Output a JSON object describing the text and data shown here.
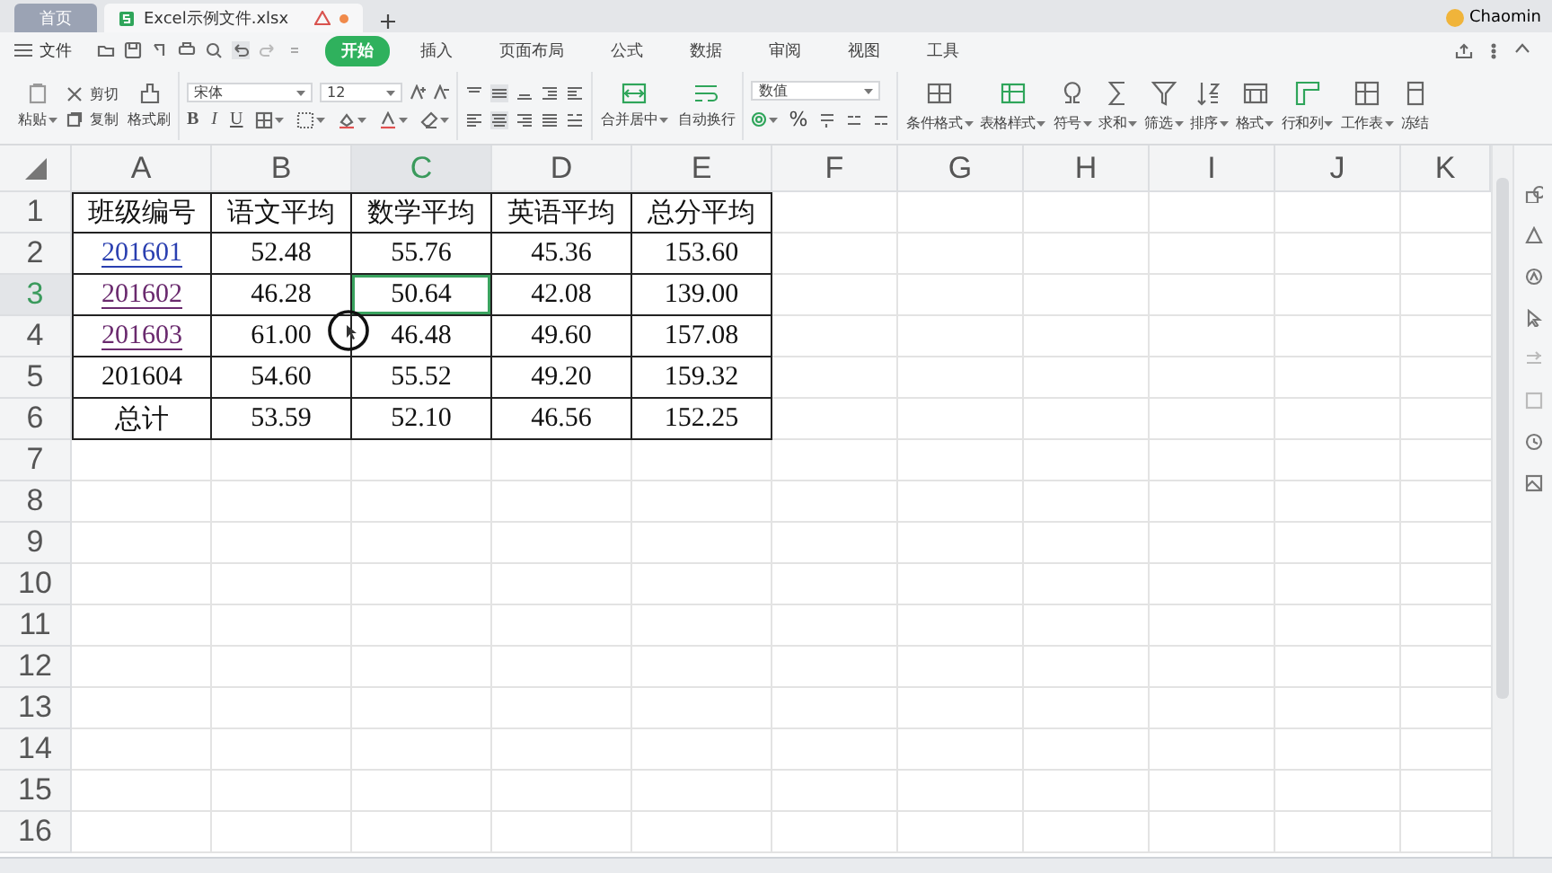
{
  "tabs": [
    {
      "label": "首页",
      "kind": "home",
      "selected": false
    },
    {
      "label": "Excel示例文件.xlsx",
      "kind": "document",
      "selected": true
    }
  ],
  "user": {
    "name": "Chaomin"
  },
  "menu": {
    "file": "文件",
    "tabs": [
      {
        "label": "开始",
        "selected": true
      },
      {
        "label": "插入",
        "selected": false
      },
      {
        "label": "页面布局",
        "selected": false
      },
      {
        "label": "公式",
        "selected": false
      },
      {
        "label": "数据",
        "selected": false
      },
      {
        "label": "审阅",
        "selected": false
      },
      {
        "label": "视图",
        "selected": false
      },
      {
        "label": "工具",
        "selected": false
      }
    ]
  },
  "ribbon": {
    "paste": {
      "label": "粘贴",
      "dropdown": true
    },
    "cut": "剪切",
    "copy": "复制",
    "format_painter": "格式刷",
    "font": {
      "name": "宋体",
      "size": "12",
      "bold": "B",
      "italic": "I",
      "underline": "U"
    },
    "merge": {
      "label": "合并居中",
      "dropdown": true
    },
    "wrap": {
      "label": "自动换行",
      "dropdown": false
    },
    "number_format": "数值",
    "percent": "%",
    "tools": [
      {
        "label": "条件格式",
        "dropdown": true
      },
      {
        "label": "表格样式",
        "dropdown": true
      },
      {
        "label": "符号",
        "dropdown": true
      },
      {
        "label": "求和",
        "dropdown": true
      },
      {
        "label": "筛选",
        "dropdown": true
      },
      {
        "label": "排序",
        "dropdown": true
      },
      {
        "label": "格式",
        "dropdown": true
      },
      {
        "label": "行和列",
        "dropdown": true
      },
      {
        "label": "工作表",
        "dropdown": true
      },
      {
        "label": "冻结",
        "dropdown": false
      }
    ]
  },
  "grid": {
    "columns": [
      {
        "label": "A",
        "selected": false
      },
      {
        "label": "B",
        "selected": false
      },
      {
        "label": "C",
        "selected": true
      },
      {
        "label": "D",
        "selected": false
      },
      {
        "label": "E",
        "selected": false
      },
      {
        "label": "F",
        "selected": false
      },
      {
        "label": "G",
        "selected": false
      },
      {
        "label": "H",
        "selected": false
      },
      {
        "label": "I",
        "selected": false
      },
      {
        "label": "J",
        "selected": false
      },
      {
        "label": "K",
        "selected": false
      }
    ],
    "rows": [
      {
        "number": "1",
        "selected": false,
        "cells": [
          {
            "text": "班级编号",
            "kind": "text",
            "selected": false
          },
          {
            "text": "语文平均",
            "kind": "text",
            "selected": false
          },
          {
            "text": "数学平均",
            "kind": "text",
            "selected": false
          },
          {
            "text": "英语平均",
            "kind": "text",
            "selected": false
          },
          {
            "text": "总分平均",
            "kind": "text",
            "selected": false
          }
        ]
      },
      {
        "number": "2",
        "selected": false,
        "cells": [
          {
            "text": "201601",
            "kind": "link",
            "visited": false,
            "selected": false
          },
          {
            "text": "52.48",
            "kind": "text",
            "selected": false
          },
          {
            "text": "55.76",
            "kind": "text",
            "selected": false
          },
          {
            "text": "45.36",
            "kind": "text",
            "selected": false
          },
          {
            "text": "153.60",
            "kind": "text",
            "selected": false
          }
        ]
      },
      {
        "number": "3",
        "selected": true,
        "cells": [
          {
            "text": "201602",
            "kind": "link",
            "visited": true,
            "selected": false
          },
          {
            "text": "46.28",
            "kind": "text",
            "selected": false
          },
          {
            "text": "50.64",
            "kind": "text",
            "selected": true
          },
          {
            "text": "42.08",
            "kind": "text",
            "selected": false
          },
          {
            "text": "139.00",
            "kind": "text",
            "selected": false
          }
        ]
      },
      {
        "number": "4",
        "selected": false,
        "cells": [
          {
            "text": "201603",
            "kind": "link",
            "visited": true,
            "selected": false
          },
          {
            "text": "61.00",
            "kind": "text",
            "selected": false
          },
          {
            "text": "46.48",
            "kind": "text",
            "selected": false
          },
          {
            "text": "49.60",
            "kind": "text",
            "selected": false
          },
          {
            "text": "157.08",
            "kind": "text",
            "selected": false
          }
        ]
      },
      {
        "number": "5",
        "selected": false,
        "cells": [
          {
            "text": "201604",
            "kind": "text",
            "selected": false
          },
          {
            "text": "54.60",
            "kind": "text",
            "selected": false
          },
          {
            "text": "55.52",
            "kind": "text",
            "selected": false
          },
          {
            "text": "49.20",
            "kind": "text",
            "selected": false
          },
          {
            "text": "159.32",
            "kind": "text",
            "selected": false
          }
        ]
      },
      {
        "number": "6",
        "selected": false,
        "cells": [
          {
            "text": "总计",
            "kind": "text",
            "selected": false
          },
          {
            "text": "53.59",
            "kind": "text",
            "selected": false
          },
          {
            "text": "52.10",
            "kind": "text",
            "selected": false
          },
          {
            "text": "46.56",
            "kind": "text",
            "selected": false
          },
          {
            "text": "152.25",
            "kind": "text",
            "selected": false
          }
        ]
      },
      {
        "number": "7",
        "selected": false
      },
      {
        "number": "8",
        "selected": false
      },
      {
        "number": "9",
        "selected": false
      },
      {
        "number": "10",
        "selected": false
      },
      {
        "number": "11",
        "selected": false
      },
      {
        "number": "12",
        "selected": false
      },
      {
        "number": "13",
        "selected": false
      },
      {
        "number": "14",
        "selected": false
      },
      {
        "number": "15",
        "selected": false
      },
      {
        "number": "16",
        "selected": false
      }
    ]
  }
}
